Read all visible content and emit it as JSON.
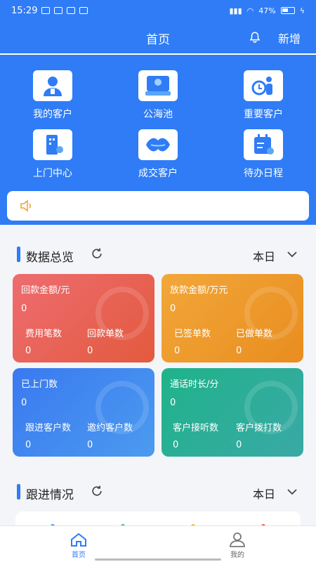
{
  "status_bar": {
    "time": "15:29",
    "battery": "47%"
  },
  "header": {
    "title": "首页",
    "add_label": "新增"
  },
  "quick_actions": [
    {
      "label": "我的客户",
      "icon": "customer-icon"
    },
    {
      "label": "公海池",
      "icon": "public-pool-icon"
    },
    {
      "label": "重要客户",
      "icon": "important-customer-icon"
    },
    {
      "label": "上门中心",
      "icon": "visit-center-icon"
    },
    {
      "label": "成交客户",
      "icon": "deal-customer-icon"
    },
    {
      "label": "待办日程",
      "icon": "calendar-icon"
    }
  ],
  "data_overview": {
    "title": "数据总览",
    "period": "本日",
    "cards": [
      {
        "title": "回款金额/元",
        "value": "0",
        "sub": [
          {
            "label": "费用笔数",
            "value": "0"
          },
          {
            "label": "回款单数",
            "value": "0"
          }
        ]
      },
      {
        "title": "放款金额/万元",
        "value": "0",
        "sub": [
          {
            "label": "已签单数",
            "value": "0"
          },
          {
            "label": "已做单数",
            "value": "0"
          }
        ]
      },
      {
        "title": "已上门数",
        "value": "0",
        "sub": [
          {
            "label": "跟进客户数",
            "value": "0"
          },
          {
            "label": "邀约客户数",
            "value": "0"
          }
        ]
      },
      {
        "title": "通话时长/分",
        "value": "0",
        "sub": [
          {
            "label": "客户接听数",
            "value": "0"
          },
          {
            "label": "客户拨打数",
            "value": "0"
          }
        ]
      }
    ]
  },
  "follow_up": {
    "title": "跟进情况",
    "period": "本日"
  },
  "tabbar": {
    "home": "首页",
    "mine": "我的"
  },
  "colors": {
    "brand": "#2f7cf6"
  }
}
